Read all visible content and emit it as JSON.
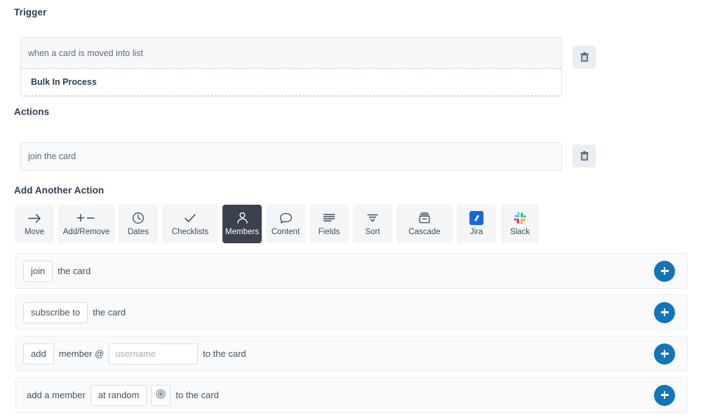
{
  "sections": {
    "trigger_title": "Trigger",
    "actions_title": "Actions",
    "add_another_title": "Add Another Action"
  },
  "trigger": {
    "description": "when a card is moved into list",
    "list_name": "Bulk In Process",
    "delete_icon": "trash-icon"
  },
  "action": {
    "description": "join the card",
    "delete_icon": "trash-icon"
  },
  "tabs": [
    {
      "label": "Move",
      "icon": "arrow-right-icon",
      "active": false
    },
    {
      "label": "Add/Remove",
      "icon": "plus-minus-icon",
      "active": false
    },
    {
      "label": "Dates",
      "icon": "clock-icon",
      "active": false
    },
    {
      "label": "Checklists",
      "icon": "check-icon",
      "active": false
    },
    {
      "label": "Members",
      "icon": "person-icon",
      "active": true
    },
    {
      "label": "Content",
      "icon": "comment-icon",
      "active": false
    },
    {
      "label": "Fields",
      "icon": "lines-icon",
      "active": false
    },
    {
      "label": "Sort",
      "icon": "sort-funnel-icon",
      "active": false
    },
    {
      "label": "Cascade",
      "icon": "archive-box-icon",
      "active": false
    },
    {
      "label": "Jira",
      "icon": "jira-icon",
      "active": false
    },
    {
      "label": "Slack",
      "icon": "slack-icon",
      "active": false
    }
  ],
  "option_rows": [
    {
      "pill": "join",
      "text_after": "the card",
      "add_icon": "plus-icon"
    },
    {
      "pill": "subscribe to",
      "text_after": "the card",
      "add_icon": "plus-icon"
    },
    {
      "pill": "add",
      "text_mid": "member @",
      "input_placeholder": "username",
      "input_value": "",
      "text_after": "to the card",
      "add_icon": "plus-icon"
    },
    {
      "text_before": "add a member",
      "pill": "at random",
      "target_icon": "target-icon",
      "text_after": "to the card",
      "add_icon": "plus-icon"
    }
  ],
  "colors": {
    "accent_blue": "#1175ba",
    "active_tab_bg": "#3c4150",
    "jira_blue": "#1868db",
    "row_bg": "#f9fafb"
  }
}
